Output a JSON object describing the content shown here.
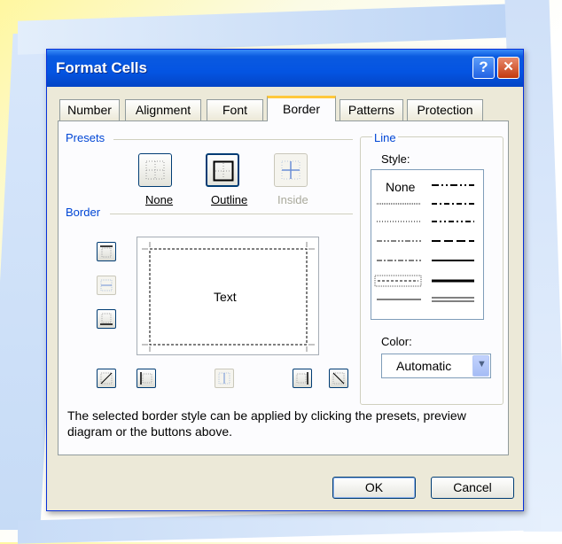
{
  "window": {
    "title": "Format Cells"
  },
  "titlebar_buttons": {
    "help": "?",
    "close": "✕"
  },
  "tabs": [
    {
      "label": "Number"
    },
    {
      "label": "Alignment"
    },
    {
      "label": "Font"
    },
    {
      "label": "Border",
      "active": true
    },
    {
      "label": "Patterns"
    },
    {
      "label": "Protection"
    }
  ],
  "presets": {
    "heading": "Presets",
    "items": [
      {
        "label": "None",
        "enabled": true
      },
      {
        "label": "Outline",
        "enabled": true
      },
      {
        "label": "Inside",
        "enabled": false
      }
    ]
  },
  "border": {
    "heading": "Border",
    "preview_text": "Text"
  },
  "line": {
    "heading": "Line",
    "style_label": "Style:",
    "style_none": "None",
    "color_label": "Color:",
    "color_value": "Automatic"
  },
  "help_text": "The selected border style can be applied by clicking the presets, preview diagram or the buttons above.",
  "buttons": {
    "ok": "OK",
    "cancel": "Cancel"
  },
  "colors": {
    "title_bar": "#0454e2",
    "group_heading": "#0046d5",
    "active_tab_accent": "#ffc83c"
  }
}
